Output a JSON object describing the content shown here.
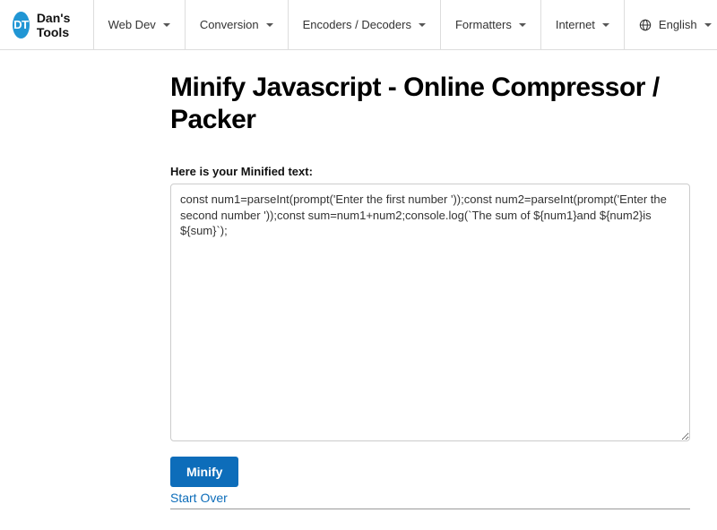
{
  "brand": {
    "logo_text": "DT",
    "name": "Dan's Tools"
  },
  "nav": {
    "items": [
      {
        "label": "Web Dev"
      },
      {
        "label": "Conversion"
      },
      {
        "label": "Encoders / Decoders"
      },
      {
        "label": "Formatters"
      },
      {
        "label": "Internet"
      }
    ],
    "language": "English"
  },
  "page": {
    "title": "Minify Javascript - Online Compressor / Packer",
    "label": "Here is your Minified text:",
    "textarea_value": "const num1=parseInt(prompt('Enter the first number '));const num2=parseInt(prompt('Enter the second number '));const sum=num1+num2;console.log(`The sum of ${num1}and ${num2}is ${sum}`);",
    "minify_button": "Minify",
    "start_over": "Start Over"
  }
}
